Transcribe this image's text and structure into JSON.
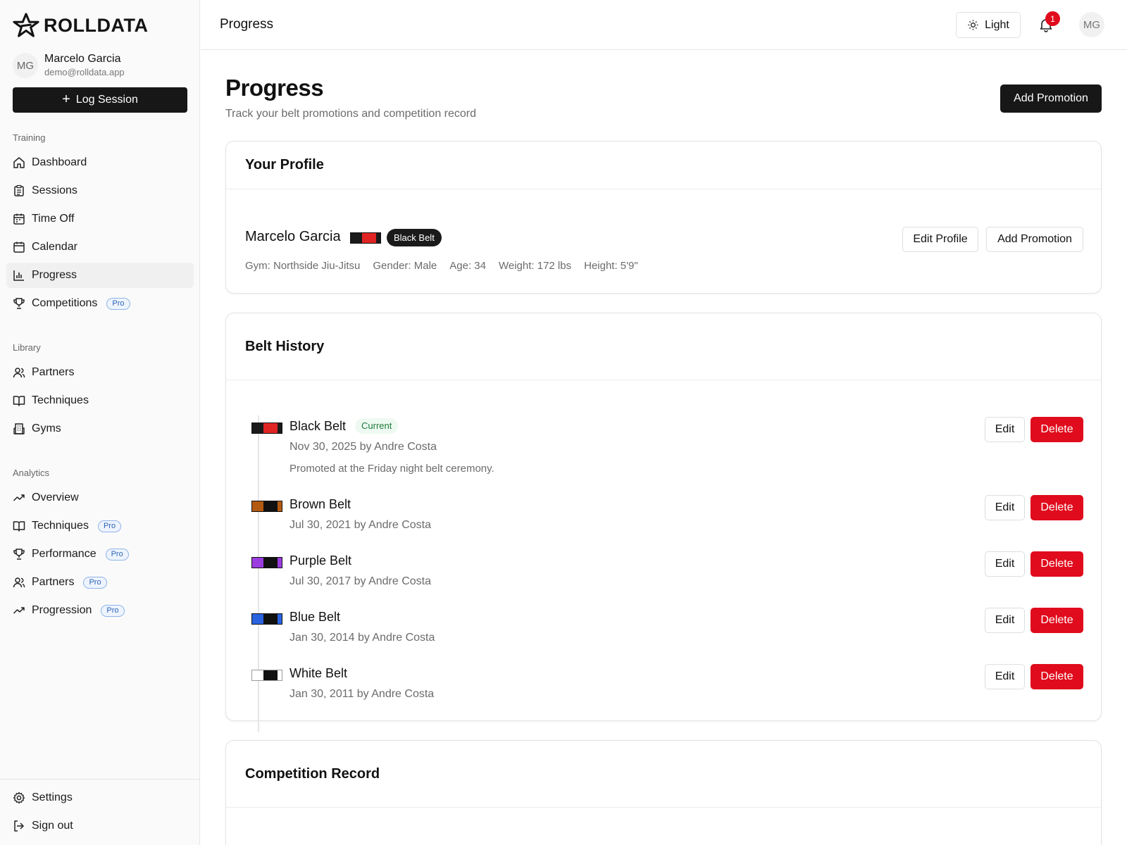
{
  "brand": {
    "name": "ROLLDATA"
  },
  "user": {
    "initials": "MG",
    "name": "Marcelo Garcia",
    "email": "demo@rolldata.app"
  },
  "sidebar": {
    "log_session": "Log Session",
    "sections": {
      "training": "Training",
      "library": "Library",
      "analytics": "Analytics"
    },
    "training_items": [
      {
        "label": "Dashboard",
        "icon": "home-icon"
      },
      {
        "label": "Sessions",
        "icon": "clipboard-icon"
      },
      {
        "label": "Time Off",
        "icon": "calendar-off-icon"
      },
      {
        "label": "Calendar",
        "icon": "calendar-icon"
      },
      {
        "label": "Progress",
        "icon": "bar-chart-icon",
        "active": true
      },
      {
        "label": "Competitions",
        "icon": "trophy-icon",
        "badge": "Pro"
      }
    ],
    "library_items": [
      {
        "label": "Partners",
        "icon": "users-icon"
      },
      {
        "label": "Techniques",
        "icon": "book-icon"
      },
      {
        "label": "Gyms",
        "icon": "building-icon"
      }
    ],
    "analytics_items": [
      {
        "label": "Overview",
        "icon": "trend-icon"
      },
      {
        "label": "Techniques",
        "icon": "book-icon",
        "badge": "Pro"
      },
      {
        "label": "Performance",
        "icon": "trophy-icon",
        "badge": "Pro"
      },
      {
        "label": "Partners",
        "icon": "users-icon",
        "badge": "Pro"
      },
      {
        "label": "Progression",
        "icon": "trend-icon",
        "badge": "Pro"
      }
    ],
    "footer_items": [
      {
        "label": "Settings",
        "icon": "gear-icon"
      },
      {
        "label": "Sign out",
        "icon": "sign-out-icon"
      }
    ]
  },
  "header": {
    "title": "Progress",
    "theme_label": "Light",
    "notification_count": "1",
    "avatar_initials": "MG"
  },
  "page": {
    "title": "Progress",
    "subtitle": "Track your belt promotions and competition record",
    "add_promotion": "Add Promotion"
  },
  "profile": {
    "heading": "Your Profile",
    "name": "Marcelo Garcia",
    "belt_badge": "Black Belt",
    "edit_profile": "Edit Profile",
    "add_promotion": "Add Promotion",
    "meta": {
      "gym": "Gym: Northside Jiu-Jitsu",
      "gender": "Gender: Male",
      "age": "Age: 34",
      "weight": "Weight: 172 lbs",
      "height": "Height: 5'9\""
    }
  },
  "belt_history": {
    "heading": "Belt History",
    "current_label": "Current",
    "edit_label": "Edit",
    "delete_label": "Delete",
    "items": [
      {
        "name": "Black Belt",
        "date": "Nov 30, 2025 by Andre Costa",
        "note": "Promoted at the Friday night belt ceremony.",
        "color": "#1a1a1a",
        "rank_color": "#e02424"
      },
      {
        "name": "Brown Belt",
        "date": "Jul 30, 2021 by Andre Costa",
        "color": "#b35a12",
        "rank_color": "#111111"
      },
      {
        "name": "Purple Belt",
        "date": "Jul 30, 2017 by Andre Costa",
        "color": "#9b3ce0",
        "rank_color": "#111111"
      },
      {
        "name": "Blue Belt",
        "date": "Jan 30, 2014 by Andre Costa",
        "color": "#2a62e0",
        "rank_color": "#111111"
      },
      {
        "name": "White Belt",
        "date": "Jan 30, 2011 by Andre Costa",
        "color": "#ffffff",
        "rank_color": "#111111"
      }
    ]
  },
  "competition": {
    "heading": "Competition Record"
  },
  "colors": {
    "accent": "#171717",
    "danger": "#e00b1c",
    "pro": "#2c63b8"
  }
}
